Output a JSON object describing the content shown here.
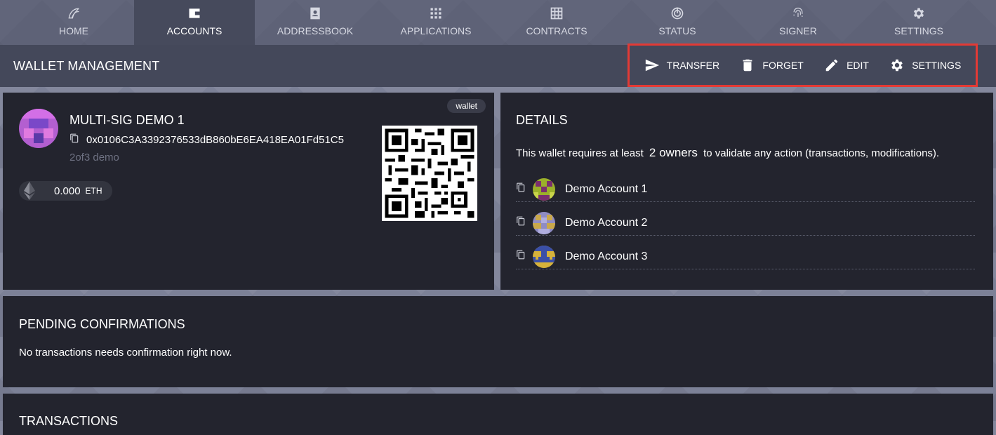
{
  "nav": {
    "tabs": [
      {
        "label": "HOME",
        "icon": "home-icon",
        "active": false
      },
      {
        "label": "ACCOUNTS",
        "icon": "wallet-icon",
        "active": true
      },
      {
        "label": "ADDRESSBOOK",
        "icon": "addressbook-icon",
        "active": false
      },
      {
        "label": "APPLICATIONS",
        "icon": "apps-grid-icon",
        "active": false
      },
      {
        "label": "CONTRACTS",
        "icon": "contracts-grid-icon",
        "active": false
      },
      {
        "label": "STATUS",
        "icon": "status-icon",
        "active": false
      },
      {
        "label": "SIGNER",
        "icon": "fingerprint-icon",
        "active": false
      },
      {
        "label": "SETTINGS",
        "icon": "gear-icon",
        "active": false
      }
    ]
  },
  "header": {
    "title": "WALLET MANAGEMENT",
    "actions": [
      {
        "label": "TRANSFER",
        "icon": "send-icon"
      },
      {
        "label": "FORGET",
        "icon": "trash-icon"
      },
      {
        "label": "EDIT",
        "icon": "pencil-icon"
      },
      {
        "label": "SETTINGS",
        "icon": "gear-icon"
      }
    ],
    "highlight_color": "#e33a35"
  },
  "wallet": {
    "tag": "wallet",
    "name": "MULTI-SIG DEMO 1",
    "address": "0x0106C3A3392376533dB860bE6EA418EA01Fd51C5",
    "description": "2of3 demo",
    "balance": "0.000",
    "balance_unit": "ETH"
  },
  "details": {
    "title": "DETAILS",
    "text_before": "This wallet requires at least",
    "owner_count": "2 owners",
    "text_after": "to validate any action (transactions, modifications).",
    "owners": [
      {
        "name": "Demo Account 1"
      },
      {
        "name": "Demo Account 2"
      },
      {
        "name": "Demo Account 3"
      }
    ]
  },
  "pending": {
    "title": "PENDING CONFIRMATIONS",
    "text": "No transactions needs confirmation right now."
  },
  "transactions": {
    "title": "TRANSACTIONS"
  },
  "colors": {
    "card_bg": "#23242e",
    "header_bg": "#44485a",
    "page_bg": "#7c8197"
  }
}
